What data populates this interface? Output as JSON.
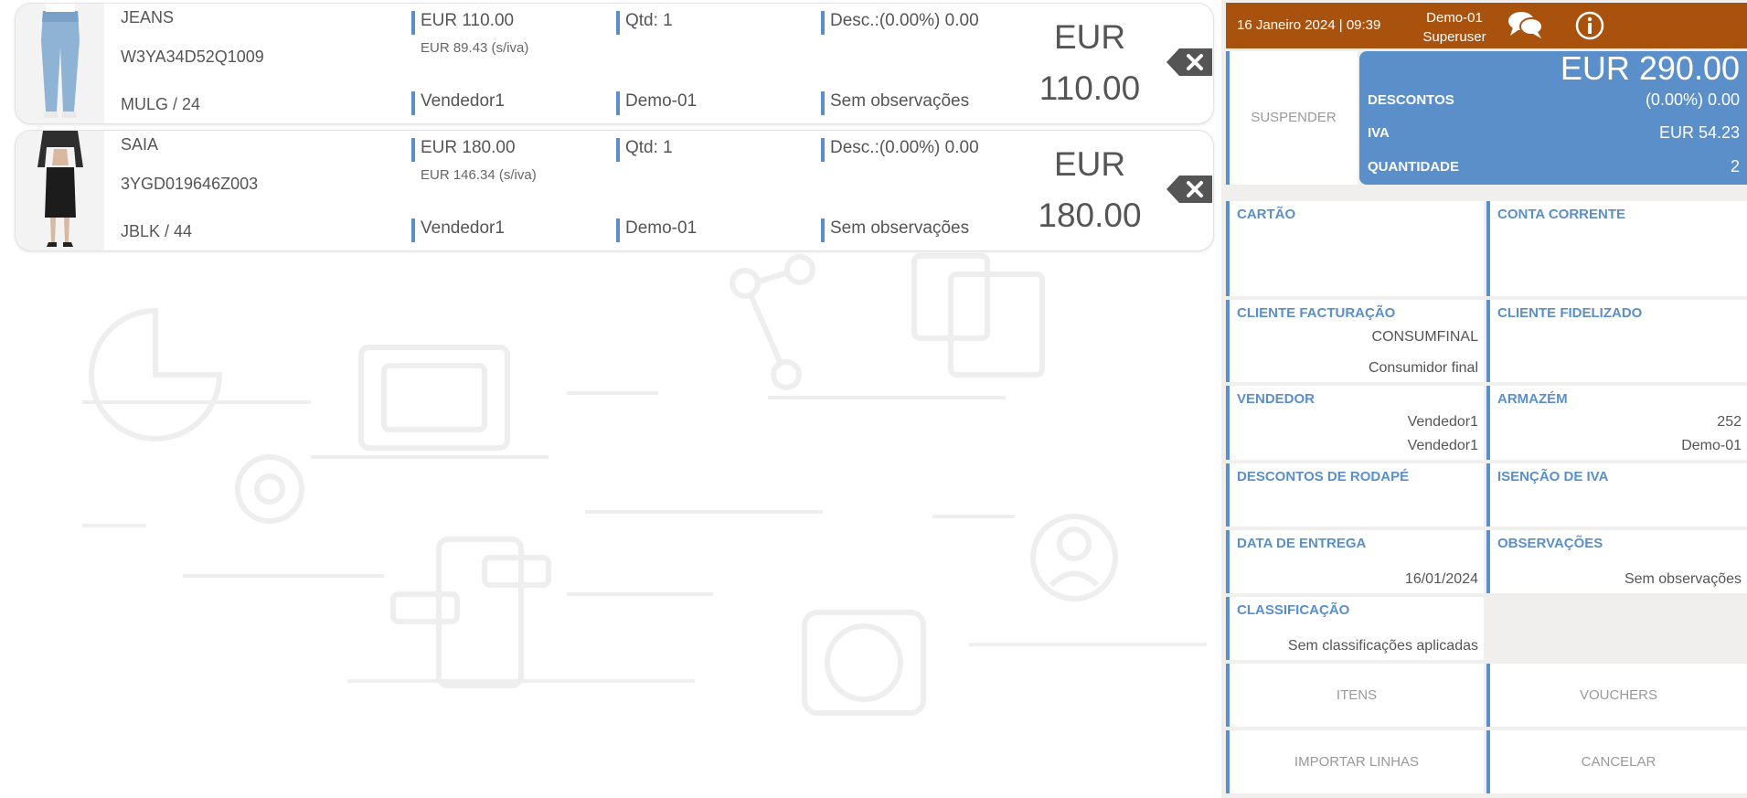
{
  "lines": [
    {
      "name": "JEANS",
      "ref": "W3YA34D52Q1009",
      "variant": "MULG / 24",
      "price": "EUR 110.00",
      "price_net": "EUR 89.43 (s/iva)",
      "qty": "Qtd: 1",
      "discount": "Desc.:(0.00%) 0.00",
      "seller": "Vendedor1",
      "store": "Demo-01",
      "notes": "Sem observações",
      "total_currency": "EUR",
      "total_value": "110.00"
    },
    {
      "name": "SAIA",
      "ref": "3YGD019646Z003",
      "variant": "JBLK / 44",
      "price": "EUR 180.00",
      "price_net": "EUR 146.34 (s/iva)",
      "qty": "Qtd: 1",
      "discount": "Desc.:(0.00%) 0.00",
      "seller": "Vendedor1",
      "store": "Demo-01",
      "notes": "Sem observações",
      "total_currency": "EUR",
      "total_value": "180.00"
    }
  ],
  "header": {
    "datetime": "16 Janeiro 2024 | 09:39",
    "store": "Demo-01",
    "user": "Superuser",
    "chat_icon": "chat-icon",
    "info_icon": "info-icon"
  },
  "actions": {
    "suspend": "SUSPENDER",
    "items": "ITENS",
    "vouchers": "VOUCHERS",
    "import_lines": "IMPORTAR LINHAS",
    "cancel": "CANCELAR"
  },
  "summary": {
    "total": "EUR 290.00",
    "discounts_label": "DESCONTOS",
    "discounts_value": "(0.00%) 0.00",
    "vat_label": "IVA",
    "vat_value": "EUR 54.23",
    "qty_label": "QUANTIDADE",
    "qty_value": "2"
  },
  "cards": {
    "card": {
      "title": "CARTÃO"
    },
    "account": {
      "title": "CONTA CORRENTE"
    },
    "billing_client": {
      "title": "CLIENTE FACTURAÇÃO",
      "code": "CONSUMFINAL",
      "name": "Consumidor final"
    },
    "loyalty_client": {
      "title": "CLIENTE FIDELIZADO"
    },
    "seller": {
      "title": "VENDEDOR",
      "line1": "Vendedor1",
      "line2": "Vendedor1"
    },
    "warehouse": {
      "title": "ARMAZÉM",
      "line1": "252",
      "line2": "Demo-01"
    },
    "footer_discounts": {
      "title": "DESCONTOS DE RODAPÉ"
    },
    "vat_exemption": {
      "title": "ISENÇÃO DE IVA"
    },
    "delivery_date": {
      "title": "DATA DE ENTREGA",
      "value": "16/01/2024"
    },
    "notes": {
      "title": "OBSERVAÇÕES",
      "value": "Sem observações"
    },
    "classification": {
      "title": "CLASSIFICAÇÃO",
      "value": "Sem classificações aplicadas"
    }
  },
  "colors": {
    "accent": "#5b8fc9",
    "header": "#a9520d",
    "panel_bg": "#f1efed"
  }
}
